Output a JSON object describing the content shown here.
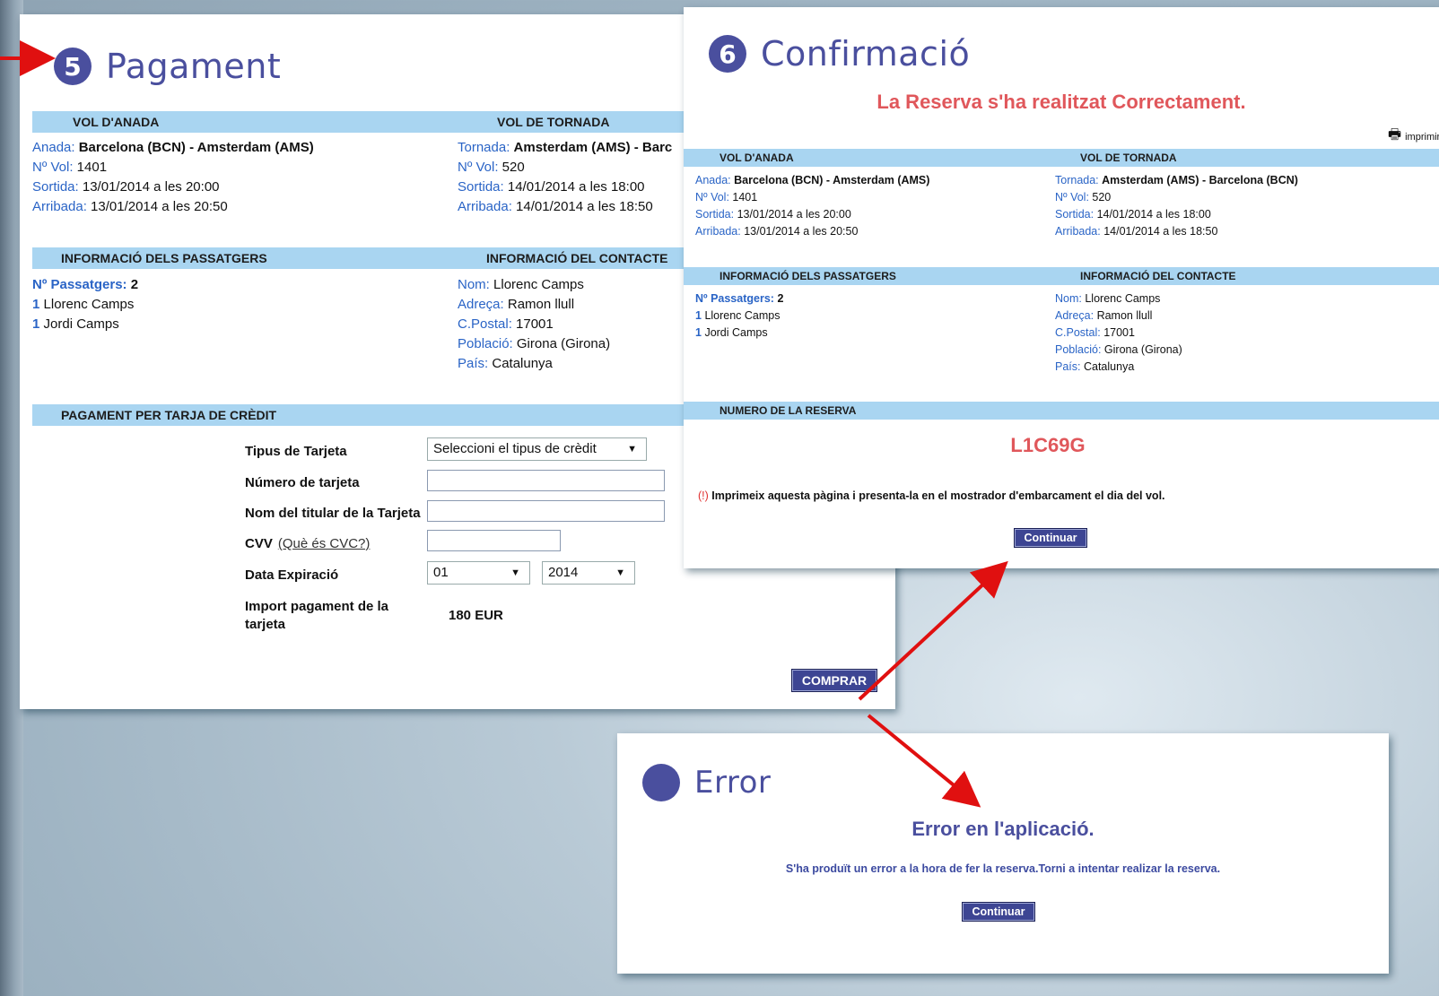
{
  "pay": {
    "step": "5",
    "title": "Pagament",
    "outbound_header": "VOL D'ANADA",
    "return_header": "VOL DE TORNADA",
    "outbound": {
      "route_label": "Anada:",
      "route": "Barcelona (BCN) - Amsterdam (AMS)",
      "flight_label": "Nº Vol:",
      "flight": "1401",
      "dep_label": "Sortida:",
      "dep": "13/01/2014 a les 20:00",
      "arr_label": "Arribada:",
      "arr": "13/01/2014 a les 20:50"
    },
    "return": {
      "route_label": "Tornada:",
      "route": "Amsterdam (AMS) - Barc",
      "flight_label": "Nº Vol:",
      "flight": "520",
      "dep_label": "Sortida:",
      "dep": "14/01/2014 a les 18:00",
      "arr_label": "Arribada:",
      "arr": "14/01/2014 a les 18:50"
    },
    "passengers_header": "INFORMACIÓ DELS PASSATGERS",
    "contact_header": "INFORMACIÓ DEL CONTACTE",
    "passengers": {
      "count_label": "Nº Passatgers:",
      "count": "2",
      "list": [
        {
          "n": "1",
          "name": "Llorenc Camps"
        },
        {
          "n": "1",
          "name": "Jordi Camps"
        }
      ]
    },
    "contact": {
      "name_label": "Nom:",
      "name": "Llorenc Camps",
      "addr_label": "Adreça:",
      "addr": "Ramon llull",
      "zip_label": "C.Postal:",
      "zip": "17001",
      "city_label": "Població:",
      "city": "Girona (Girona)",
      "country_label": "País:",
      "country": "Catalunya"
    },
    "card_header": "PAGAMENT PER TARJA DE CRÈDIT",
    "form": {
      "type_label": "Tipus de Tarjeta",
      "type_value": "Seleccioni el tipus de crèdit",
      "number_label": "Número de tarjeta",
      "holder_label": "Nom del titular de la Tarjeta",
      "cvv_label": "CVV",
      "cvv_link": "(Què és CVC?)",
      "expiry_label": "Data Expiració",
      "expiry_month": "01",
      "expiry_year": "2014",
      "amount_label": "Import pagament de la tarjeta",
      "amount": "180 EUR"
    },
    "buy_button": "COMPRAR"
  },
  "conf": {
    "step": "6",
    "title": "Confirmació",
    "success_msg": "La Reserva s'ha realitzat Correctament.",
    "print_label": "imprimir",
    "outbound_header": "VOL D'ANADA",
    "return_header": "VOL DE TORNADA",
    "outbound": {
      "route_label": "Anada:",
      "route": "Barcelona (BCN) - Amsterdam (AMS)",
      "flight_label": "Nº Vol:",
      "flight": "1401",
      "dep_label": "Sortida:",
      "dep": "13/01/2014 a les 20:00",
      "arr_label": "Arribada:",
      "arr": "13/01/2014 a les 20:50"
    },
    "return": {
      "route_label": "Tornada:",
      "route": "Amsterdam (AMS) - Barcelona (BCN)",
      "flight_label": "Nº Vol:",
      "flight": "520",
      "dep_label": "Sortida:",
      "dep": "14/01/2014 a les 18:00",
      "arr_label": "Arribada:",
      "arr": "14/01/2014 a les 18:50"
    },
    "passengers_header": "INFORMACIÓ DELS PASSATGERS",
    "contact_header": "INFORMACIÓ DEL CONTACTE",
    "passengers": {
      "count_label": "Nº Passatgers:",
      "count": "2",
      "list": [
        {
          "n": "1",
          "name": "Llorenc Camps"
        },
        {
          "n": "1",
          "name": "Jordi Camps"
        }
      ]
    },
    "contact": {
      "name_label": "Nom:",
      "name": "Llorenc Camps",
      "addr_label": "Adreça:",
      "addr": "Ramon llull",
      "zip_label": "C.Postal:",
      "zip": "17001",
      "city_label": "Població:",
      "city": "Girona (Girona)",
      "country_label": "País:",
      "country": "Catalunya"
    },
    "booking_header": "NUMERO DE LA RESERVA",
    "booking_code": "L1C69G",
    "note_mark": "(!)",
    "note": "Imprimeix aquesta pàgina i presenta-la en el mostrador d'embarcament el dia del vol.",
    "continue_button": "Continuar"
  },
  "err": {
    "title": "Error",
    "heading": "Error en l'aplicació.",
    "message": "S'ha produït un error a la hora de fer la reserva.Torni a intentar realizar la reserva.",
    "continue_button": "Continuar"
  },
  "colors": {
    "accent": "#4a4f9e",
    "label_blue": "#2a64c6",
    "section_bar": "#a9d5f1",
    "success_red": "#e0575b",
    "arrow_red": "#e01010"
  }
}
